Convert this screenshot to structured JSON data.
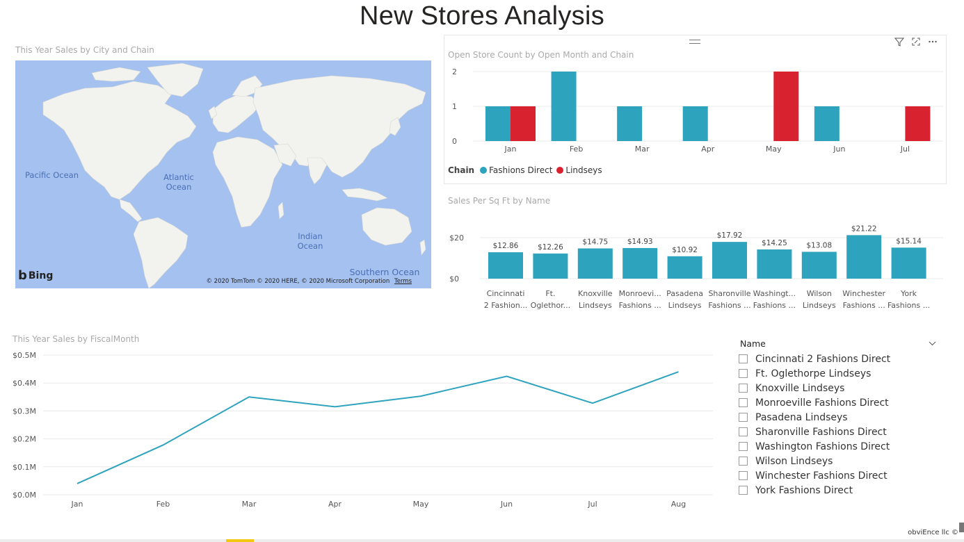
{
  "page": {
    "title": "New Stores Analysis"
  },
  "map_visual": {
    "title": "This Year Sales by City and Chain",
    "oceans": {
      "pacific": "Pacific Ocean",
      "atlantic": "Atlantic Ocean",
      "indian": "Indian Ocean",
      "southern": "Southern Ocean"
    },
    "logo": "Bing",
    "copyright": "© 2020 TomTom © 2020 HERE, © 2020 Microsoft Corporation",
    "terms": "Terms",
    "colors": {
      "water": "#a4c1ef",
      "land": "#f2f2ef"
    }
  },
  "open_store_chart": {
    "title": "Open Store Count by Open Month and Chain",
    "toolbar": {
      "filter_icon": "filter-icon",
      "focus_icon": "focus-mode-icon",
      "more_icon": "more-options-icon"
    },
    "legend_title": "Chain",
    "chart_data": {
      "type": "bar",
      "categories": [
        "Jan",
        "Feb",
        "Mar",
        "Apr",
        "May",
        "Jun",
        "Jul"
      ],
      "series": [
        {
          "name": "Fashions Direct",
          "color": "#2ea3bd",
          "values": [
            1,
            2,
            1,
            1,
            0,
            1,
            0
          ]
        },
        {
          "name": "Lindseys",
          "color": "#d9222f",
          "values": [
            1,
            0,
            0,
            0,
            2,
            0,
            1
          ]
        }
      ],
      "yticks": [
        "0",
        "1",
        "2"
      ],
      "ylim": [
        0,
        2
      ],
      "grid": true,
      "legend_position": "bottom-left"
    }
  },
  "sales_sqft_chart": {
    "title": "Sales Per Sq Ft by Name",
    "chart_data": {
      "type": "bar",
      "categories": [
        [
          "Cincinnati",
          "2 Fashion..."
        ],
        [
          "Ft.",
          "Oglethor..."
        ],
        [
          "Knoxville",
          "Lindseys"
        ],
        [
          "Monroevi...",
          "Fashions ..."
        ],
        [
          "Pasadena",
          "Lindseys"
        ],
        [
          "Sharonville",
          "Fashions ..."
        ],
        [
          "Washingt...",
          "Fashions ..."
        ],
        [
          "Wilson",
          "Lindseys"
        ],
        [
          "Winchester",
          "Fashions ..."
        ],
        [
          "York",
          "Fashions ..."
        ]
      ],
      "values": [
        12.86,
        12.26,
        14.75,
        14.93,
        10.92,
        17.92,
        14.25,
        13.08,
        21.22,
        15.14
      ],
      "data_labels": [
        "$12.86",
        "$12.26",
        "$14.75",
        "$14.93",
        "$10.92",
        "$17.92",
        "$14.25",
        "$13.08",
        "$21.22",
        "$15.14"
      ],
      "yticks": [
        "$0",
        "$20"
      ],
      "ylim": [
        0,
        20
      ],
      "color": "#2ea3bd",
      "grid": true
    }
  },
  "monthly_sales_chart": {
    "title": "This Year Sales by FiscalMonth",
    "chart_data": {
      "type": "line",
      "categories": [
        "Jan",
        "Feb",
        "Mar",
        "Apr",
        "May",
        "Jun",
        "Jul",
        "Aug"
      ],
      "values": [
        0.04,
        0.178,
        0.35,
        0.315,
        0.353,
        0.424,
        0.328,
        0.44
      ],
      "yticks": [
        "$0.0M",
        "$0.1M",
        "$0.2M",
        "$0.3M",
        "$0.4M",
        "$0.5M"
      ],
      "ylim": [
        0,
        0.5
      ],
      "unit": "$M",
      "color": "#2ea3bd",
      "grid": true
    }
  },
  "slicer": {
    "header": "Name",
    "chevron_icon": "chevron-down-icon",
    "items": [
      "Cincinnati 2 Fashions Direct",
      "Ft. Oglethorpe Lindseys",
      "Knoxville Lindseys",
      "Monroeville Fashions Direct",
      "Pasadena Lindseys",
      "Sharonville Fashions Direct",
      "Washington Fashions Direct",
      "Wilson Lindseys",
      "Winchester Fashions Direct",
      "York Fashions Direct"
    ]
  },
  "footer": {
    "text": "obviEnce llc ©"
  }
}
